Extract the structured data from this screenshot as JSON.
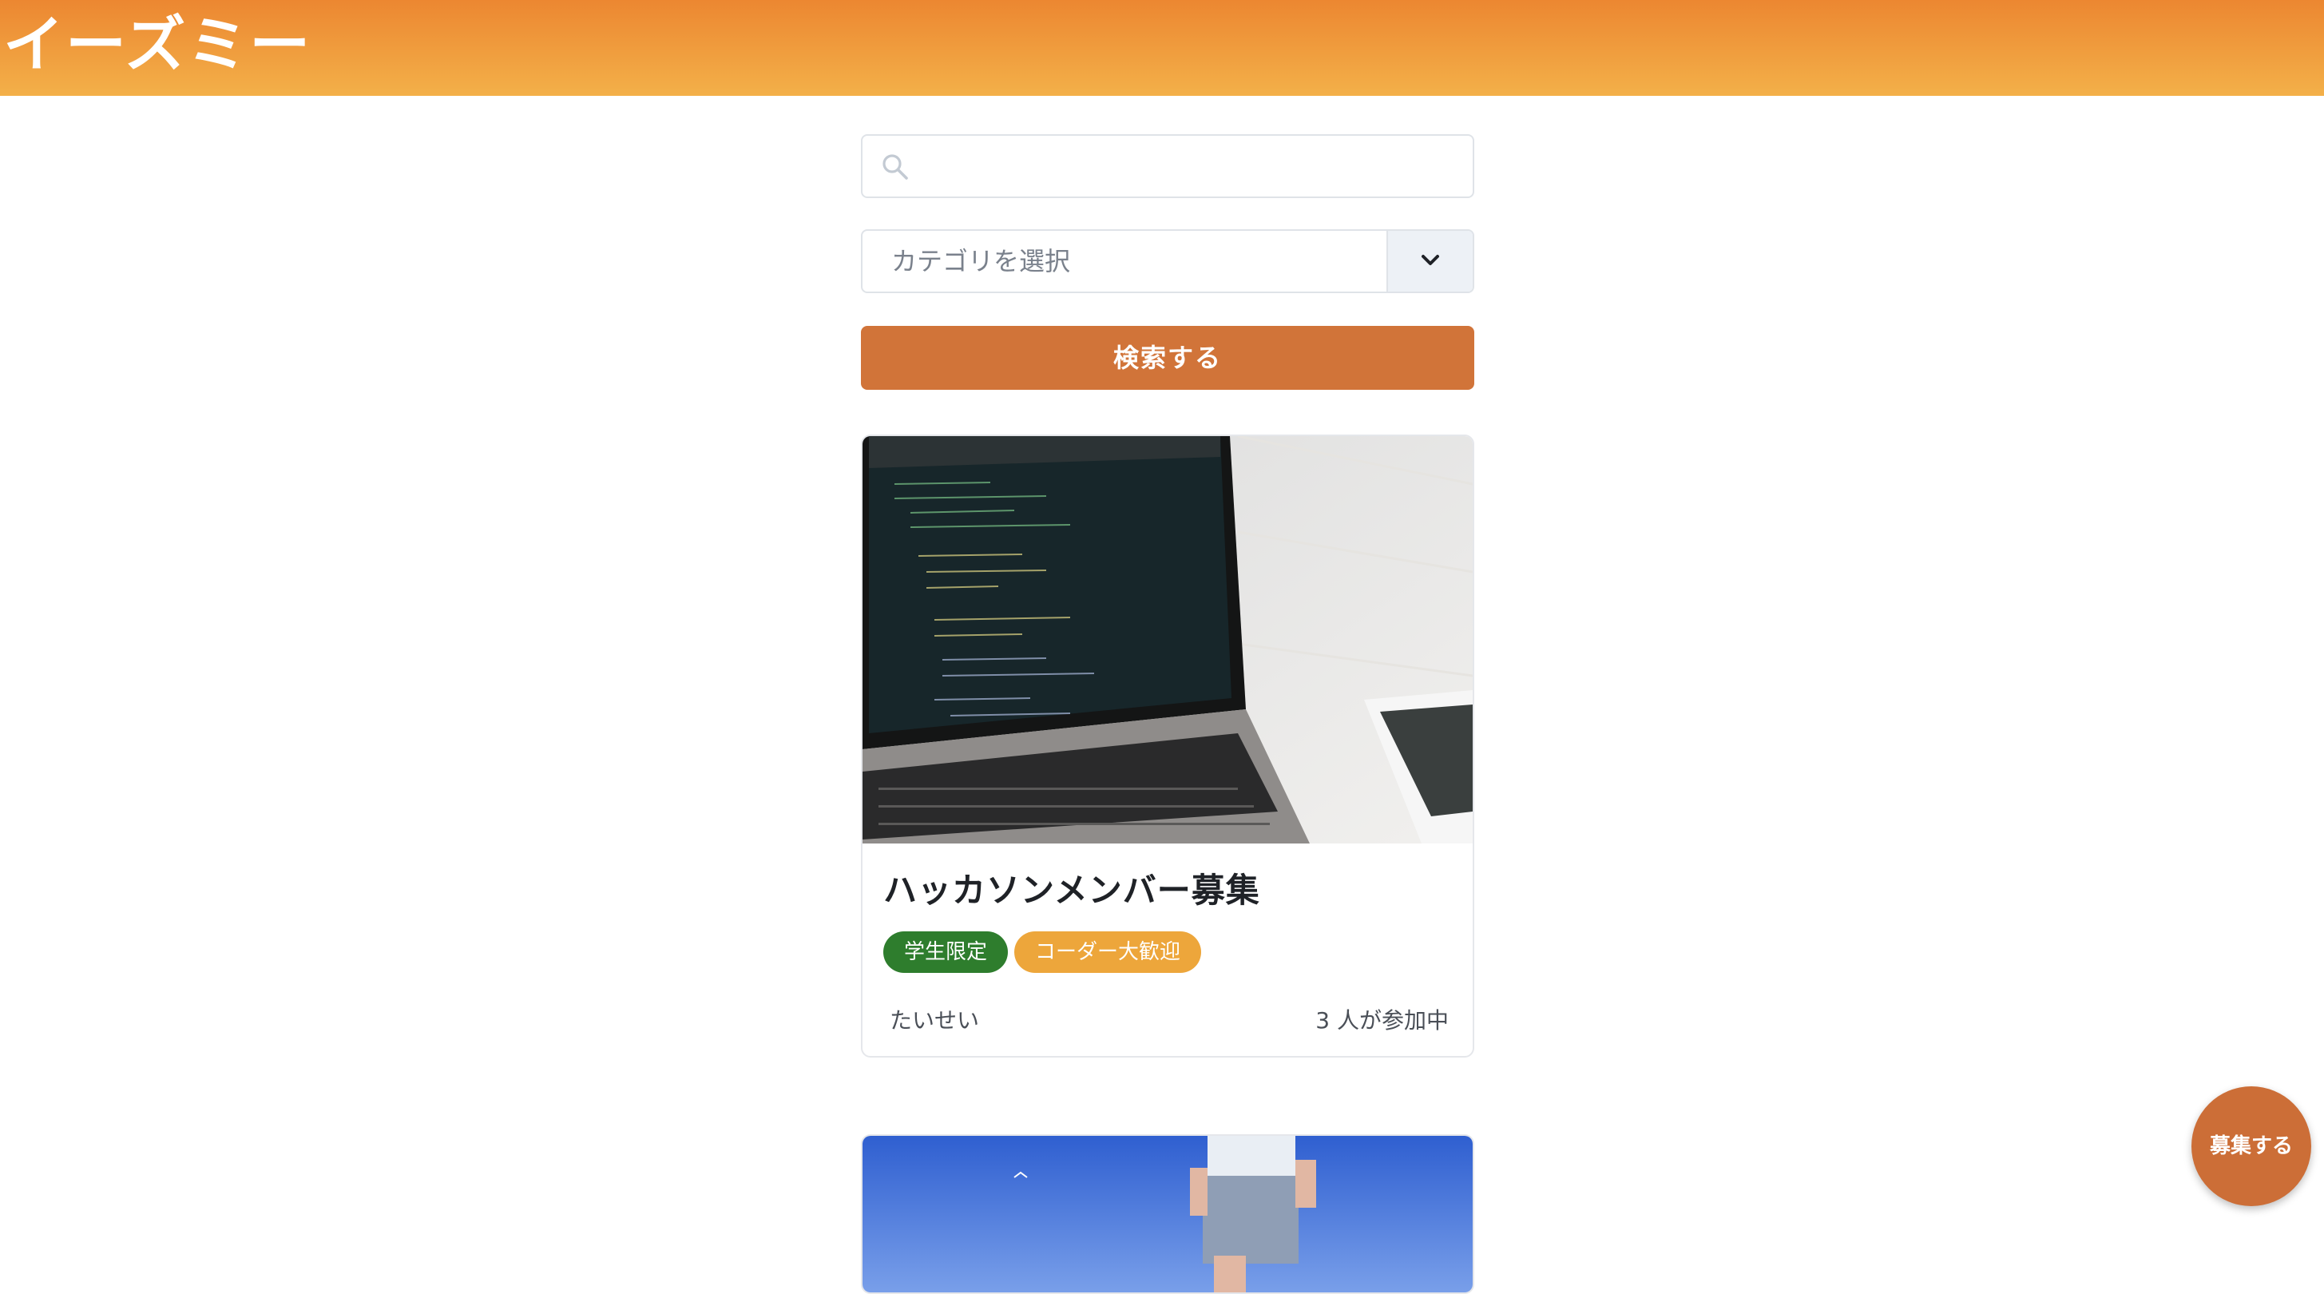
{
  "header": {
    "brand": "イーズミー"
  },
  "search": {
    "placeholder": "",
    "icon": "search-icon"
  },
  "category_select": {
    "selected": "カテゴリを選択",
    "icon": "chevron-down-icon"
  },
  "search_button": {
    "label": "検索する"
  },
  "cards": [
    {
      "title": "ハッカソンメンバー募集",
      "tags": [
        "学生限定",
        "コーダー大歓迎"
      ],
      "author": "たいせい",
      "participants": "3 人が参加中"
    }
  ],
  "fab": {
    "label": "募集する"
  },
  "colors": {
    "header_start": "#ec8731",
    "header_end": "#f3b049",
    "primary": "#d17439",
    "tag_student": "#2e7d2d",
    "tag_coder": "#eda63b"
  }
}
